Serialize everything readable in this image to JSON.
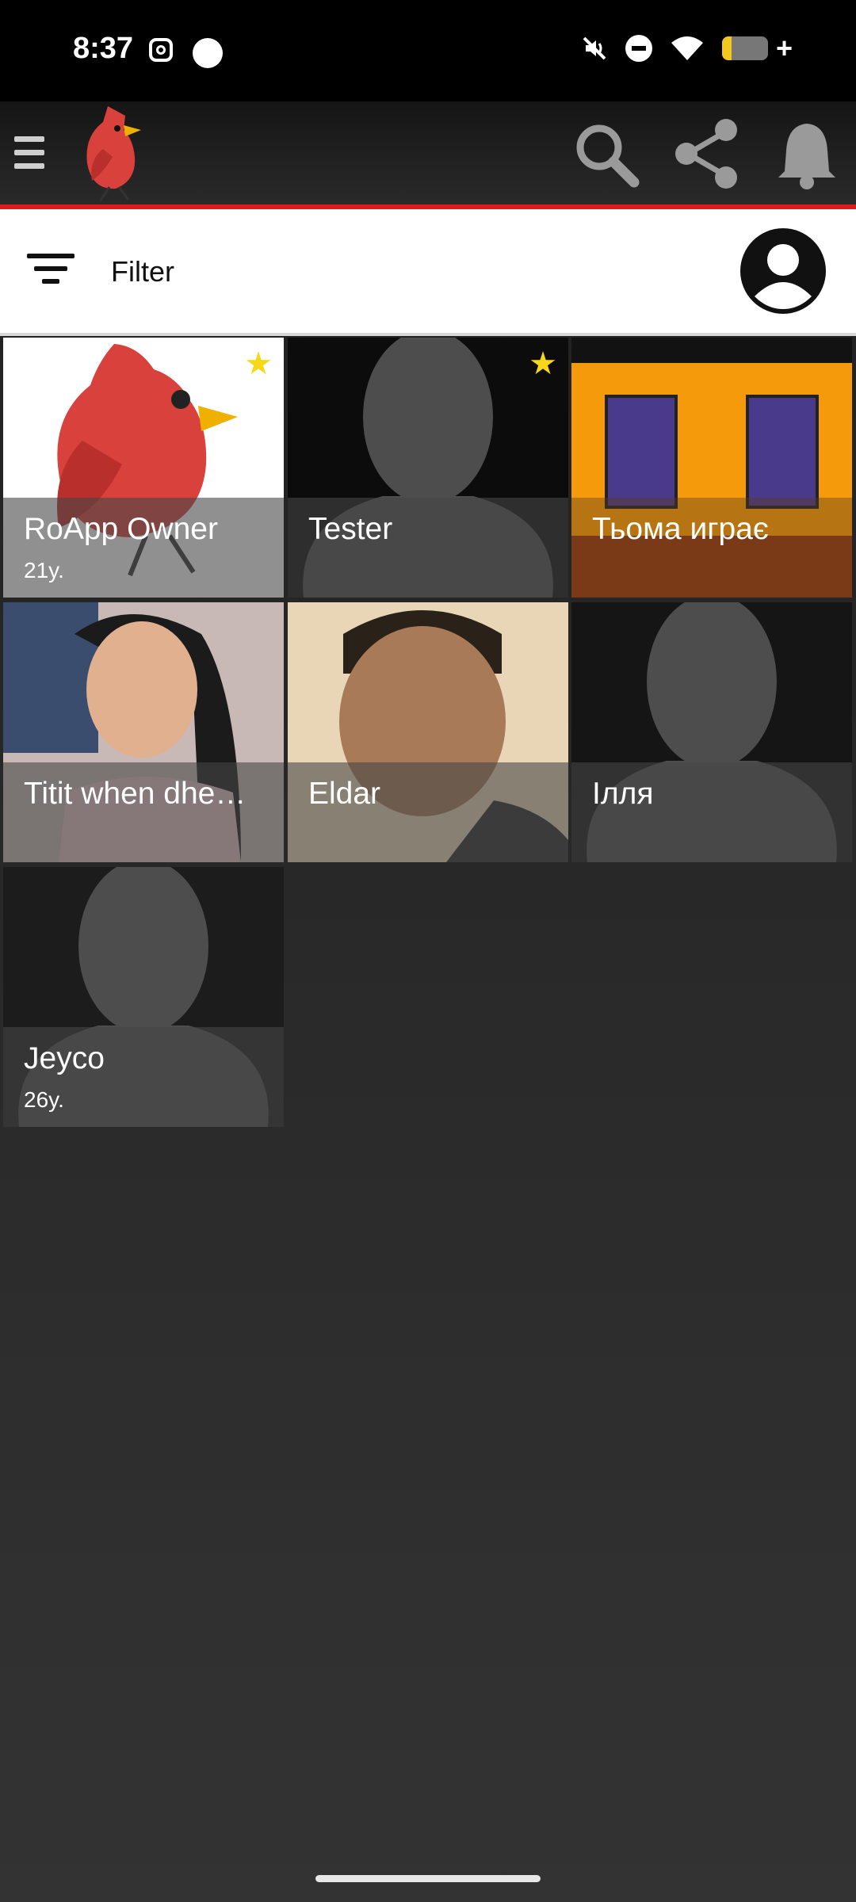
{
  "status": {
    "time": "8:37"
  },
  "appbar": {
    "menu_icon": "menu-icon",
    "logo_icon": "cardinal-bird-logo",
    "actions": [
      "search-icon",
      "share-icon",
      "bell-icon"
    ]
  },
  "filter": {
    "label": "Filter"
  },
  "profiles": [
    {
      "name": "RoApp Owner",
      "age": "21y.",
      "starred": true
    },
    {
      "name": "Tester",
      "age": "",
      "starred": true
    },
    {
      "name": "Тьома играє",
      "age": "",
      "starred": false
    },
    {
      "name": "Titit when dhe…",
      "age": "",
      "starred": false
    },
    {
      "name": "Eldar",
      "age": "",
      "starred": false
    },
    {
      "name": "Ілля",
      "age": "",
      "starred": false
    },
    {
      "name": "Jeyco",
      "age": "26y.",
      "starred": false
    }
  ],
  "colors": {
    "accent": "#e01818",
    "star": "#f6d819",
    "appbar": "#222222",
    "background": "#2a2a2a"
  }
}
